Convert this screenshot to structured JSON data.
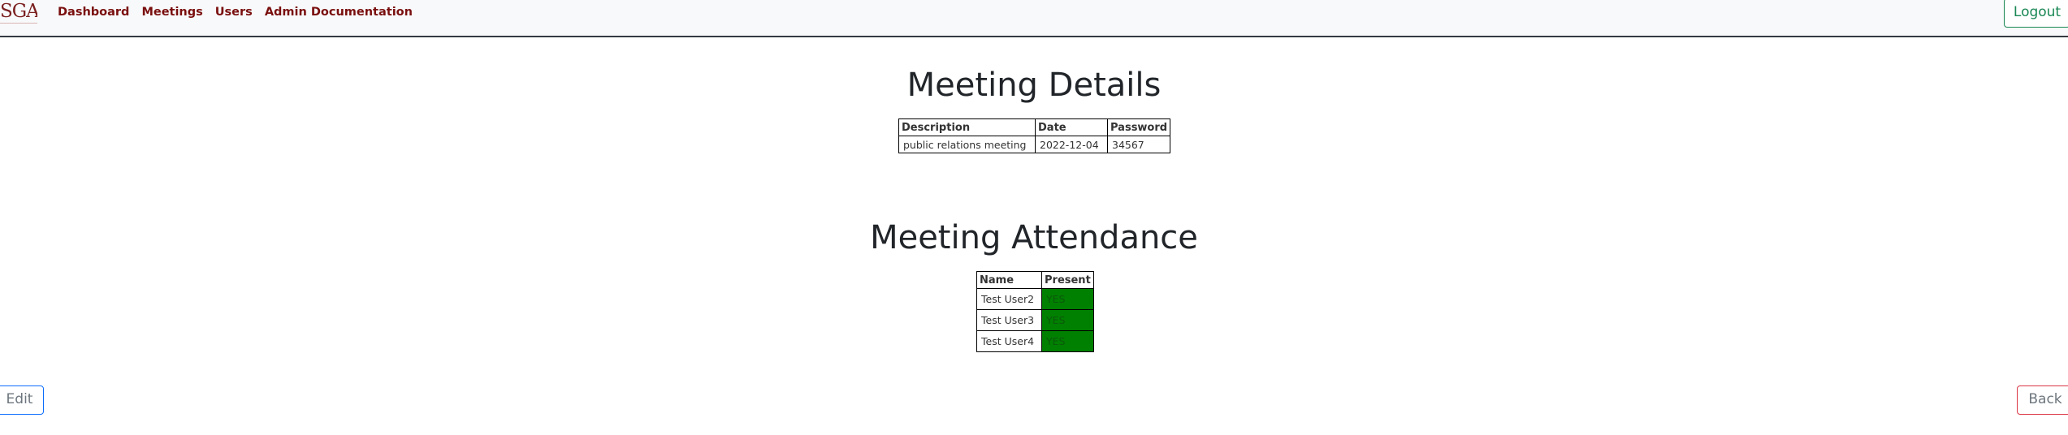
{
  "navbar": {
    "brand": "SGA",
    "links": [
      "Dashboard",
      "Meetings",
      "Users",
      "Admin Documentation"
    ],
    "logout_label": "Logout"
  },
  "meeting_details": {
    "heading": "Meeting Details",
    "columns": [
      "Description",
      "Date",
      "Password"
    ],
    "row": [
      "public relations meeting",
      "2022-12-04",
      "34567"
    ]
  },
  "attendance": {
    "heading": "Meeting Attendance",
    "columns": [
      "Name",
      "Present"
    ],
    "rows": [
      {
        "name": "Test User2",
        "present": "YES"
      },
      {
        "name": "Test User3",
        "present": "YES"
      },
      {
        "name": "Test User4",
        "present": "YES"
      }
    ],
    "present_color": "#008000"
  },
  "footer": {
    "edit_label": "Edit",
    "back_label": "Back"
  }
}
